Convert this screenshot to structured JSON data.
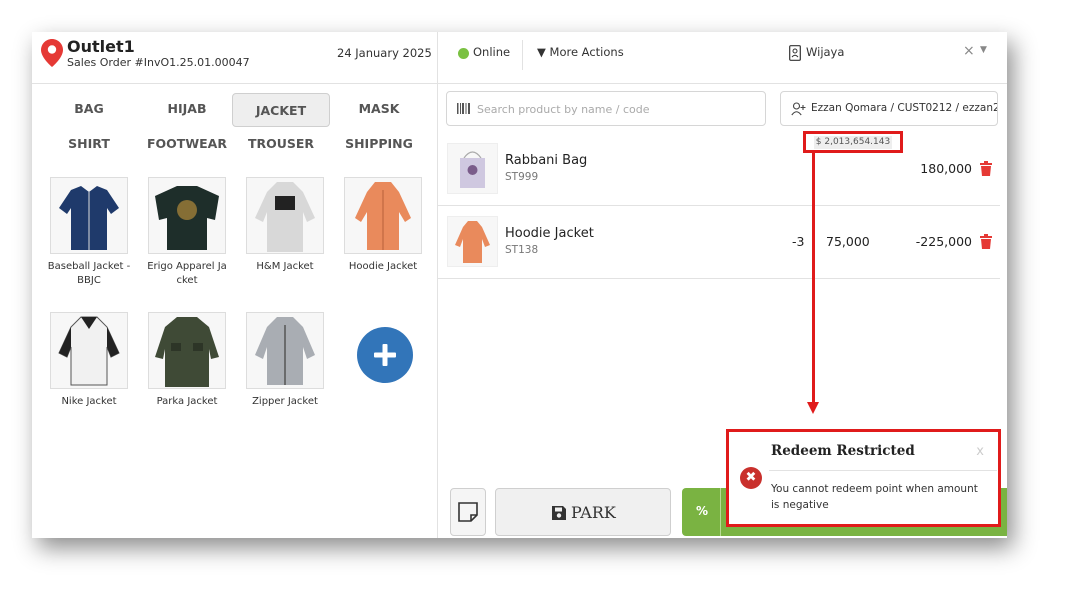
{
  "header": {
    "outlet_name": "Outlet1",
    "sales_order": "Sales Order #InvO1.25.01.00047",
    "date": "24 January 2025",
    "status": "Online",
    "more_actions": "More Actions",
    "user": "Wijaya",
    "close_symbol": "×",
    "dropdown_symbol": "▼"
  },
  "categories": [
    {
      "label": "BAG"
    },
    {
      "label": "HIJAB"
    },
    {
      "label": "JACKET"
    },
    {
      "label": "MASK"
    },
    {
      "label": "SHIRT"
    },
    {
      "label": "FOOTWEAR"
    },
    {
      "label": "TROUSER"
    },
    {
      "label": "SHIPPING"
    }
  ],
  "active_category": "JACKET",
  "products": [
    {
      "line1": "Baseball Jacket -",
      "line2": "BBJC",
      "color": "#1f3a6b"
    },
    {
      "line1": "Erigo Apparel Ja",
      "line2": "cket",
      "color": "#1e2e2a"
    },
    {
      "line1": "H&M Jacket",
      "line2": "",
      "color": "#d8d8d8"
    },
    {
      "line1": "Hoodie Jacket",
      "line2": "",
      "color": "#e98a5c"
    },
    {
      "line1": "Nike Jacket",
      "line2": "",
      "color": "#dcdcdc"
    },
    {
      "line1": "Parka Jacket",
      "line2": "",
      "color": "#3f4a36"
    },
    {
      "line1": "Zipper Jacket",
      "line2": "",
      "color": "#a9adb3"
    }
  ],
  "search": {
    "placeholder": "Search product by name / code"
  },
  "customer": {
    "text": "Ezzan Qomara / CUST0212 / ezzan2"
  },
  "balance": "$ 2,013,654.143",
  "cart": [
    {
      "name": "Rabbani Bag",
      "code": "ST999",
      "qty": "",
      "price": "",
      "total": "180,000",
      "color": "#cfc8e0"
    },
    {
      "name": "Hoodie Jacket",
      "code": "ST138",
      "qty": "-3",
      "price": "75,000",
      "total": "-225,000",
      "color": "#e98a5c"
    }
  ],
  "buttons": {
    "park": "PARK",
    "percent": "%"
  },
  "toast": {
    "title": "Redeem Restricted",
    "close": "x",
    "icon": "✖",
    "message": "You cannot redeem point when amount is negative"
  },
  "colors": {
    "accent_red": "#e01b1b",
    "online_green": "#7ac142",
    "pay_green": "#7ab342",
    "add_blue": "#3275b9",
    "pin_red": "#e53935"
  }
}
